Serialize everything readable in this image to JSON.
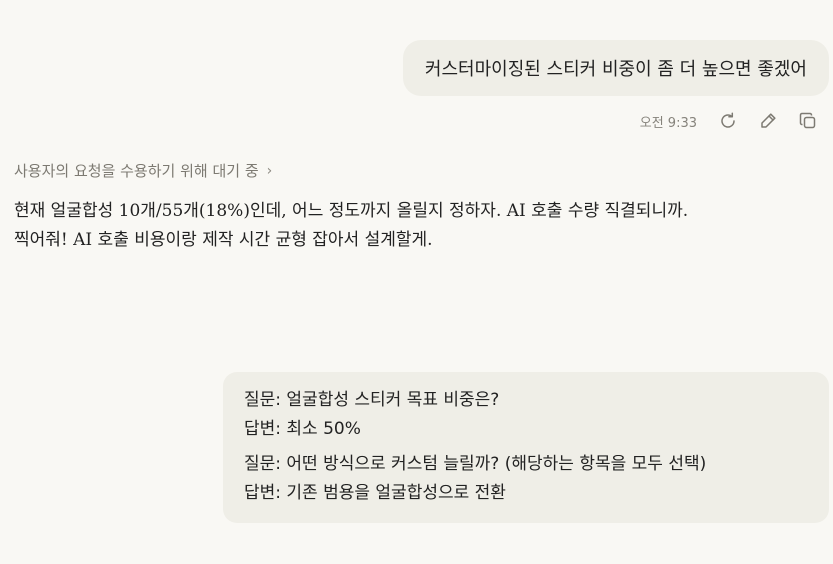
{
  "user_message": "커스터마이징된 스티커 비중이 좀 더 높으면 좋겠어",
  "message_meta": {
    "time": "오전 9:33",
    "actions": [
      {
        "name": "retry-icon"
      },
      {
        "name": "edit-icon"
      },
      {
        "name": "copy-icon"
      }
    ]
  },
  "thinking": {
    "label": "사용자의 요청을 수용하기 위해 대기 중",
    "chevron": "›"
  },
  "assistant": {
    "paragraphs": [
      "현재 얼굴합성 10개/55개(18%)인데, 어느 정도까지 올릴지 정하자. AI 호출 수량 직결되니까.",
      "찍어줘! AI 호출 비용이랑 제작 시간 균형 잡아서 설계할게."
    ]
  },
  "qa": [
    {
      "question": "질문: 얼굴합성 스티커 목표 비중은?",
      "answer": "답변: 최소 50%"
    },
    {
      "question": "질문: 어떤 방식으로 커스텀 늘릴까? (해당하는 항목을 모두 선택)",
      "answer": "답변: 기존 범용을 얼굴합성으로 전환"
    }
  ]
}
